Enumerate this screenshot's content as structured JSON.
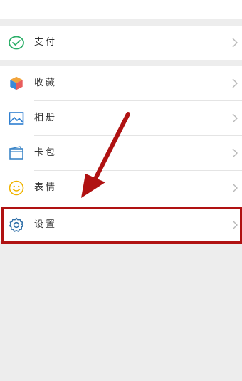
{
  "menu": {
    "pay": {
      "label": "支付",
      "icon": "pay-check-icon"
    },
    "favorites": {
      "label": "收藏",
      "icon": "cube-icon"
    },
    "album": {
      "label": "相册",
      "icon": "image-icon"
    },
    "cards": {
      "label": "卡包",
      "icon": "card-icon"
    },
    "stickers": {
      "label": "表情",
      "icon": "smiley-icon"
    },
    "settings": {
      "label": "设置",
      "icon": "gear-icon"
    }
  },
  "annotation": {
    "arrow_color": "#b01212",
    "highlight_color": "#b01212",
    "target": "settings"
  },
  "colors": {
    "pay_green": "#2aae67",
    "favorites_blue": "#3a8ad8",
    "favorites_orange": "#f2a43a",
    "album_blue": "#2f7fd0",
    "cards_blue": "#3c86c8",
    "stickers_yellow": "#f0b400",
    "settings_blue": "#2f6fa8",
    "page_bg": "#ededed"
  }
}
